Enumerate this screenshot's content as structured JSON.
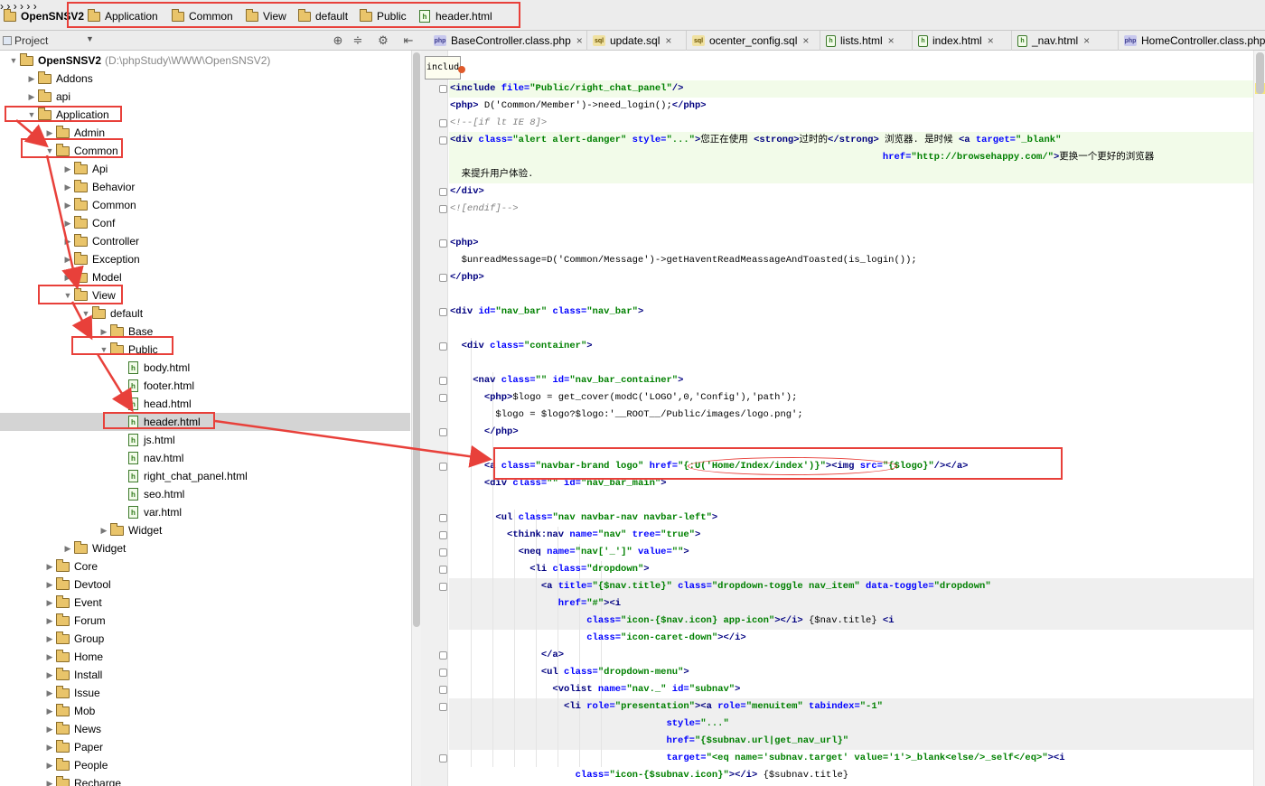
{
  "breadcrumb": {
    "items": [
      "OpenSNSV2",
      "Application",
      "Common",
      "View",
      "default",
      "Public",
      "header.html"
    ]
  },
  "project_panel": {
    "label": "Project",
    "toolbar_icons": [
      "target-icon",
      "collapse-icon",
      "gear-icon",
      "hide-panel-icon"
    ]
  },
  "tree": {
    "root_name": "OpenSNSV2",
    "root_path": "(D:\\phpStudy\\WWW\\OpenSNSV2)",
    "rows": [
      {
        "label": "Addons",
        "kind": "folder",
        "expanded": false,
        "level": 1
      },
      {
        "label": "api",
        "kind": "folder",
        "expanded": false,
        "level": 1
      },
      {
        "label": "Application",
        "kind": "folder",
        "expanded": true,
        "level": 1
      },
      {
        "label": "Admin",
        "kind": "folder",
        "expanded": false,
        "level": 2
      },
      {
        "label": "Common",
        "kind": "folder",
        "expanded": true,
        "level": 2
      },
      {
        "label": "Api",
        "kind": "folder",
        "expanded": false,
        "level": 3
      },
      {
        "label": "Behavior",
        "kind": "folder",
        "expanded": false,
        "level": 3
      },
      {
        "label": "Common",
        "kind": "folder",
        "expanded": false,
        "level": 3
      },
      {
        "label": "Conf",
        "kind": "folder",
        "expanded": false,
        "level": 3
      },
      {
        "label": "Controller",
        "kind": "folder",
        "expanded": false,
        "level": 3
      },
      {
        "label": "Exception",
        "kind": "folder",
        "expanded": false,
        "level": 3
      },
      {
        "label": "Model",
        "kind": "folder",
        "expanded": false,
        "level": 3
      },
      {
        "label": "View",
        "kind": "folder",
        "expanded": true,
        "level": 3
      },
      {
        "label": "default",
        "kind": "folder",
        "expanded": true,
        "level": 4
      },
      {
        "label": "Base",
        "kind": "folder",
        "expanded": false,
        "level": 5
      },
      {
        "label": "Public",
        "kind": "folder",
        "expanded": true,
        "level": 5
      },
      {
        "label": "body.html",
        "kind": "file",
        "level": 6
      },
      {
        "label": "footer.html",
        "kind": "file",
        "level": 6
      },
      {
        "label": "head.html",
        "kind": "file",
        "level": 6
      },
      {
        "label": "header.html",
        "kind": "file",
        "level": 6,
        "selected": true
      },
      {
        "label": "js.html",
        "kind": "file",
        "level": 6
      },
      {
        "label": "nav.html",
        "kind": "file",
        "level": 6
      },
      {
        "label": "right_chat_panel.html",
        "kind": "file",
        "level": 6
      },
      {
        "label": "seo.html",
        "kind": "file",
        "level": 6
      },
      {
        "label": "var.html",
        "kind": "file",
        "level": 6
      },
      {
        "label": "Widget",
        "kind": "folder",
        "expanded": false,
        "level": 5
      },
      {
        "label": "Widget",
        "kind": "folder",
        "expanded": false,
        "level": 3
      },
      {
        "label": "Core",
        "kind": "folder",
        "expanded": false,
        "level": 2
      },
      {
        "label": "Devtool",
        "kind": "folder",
        "expanded": false,
        "level": 2
      },
      {
        "label": "Event",
        "kind": "folder",
        "expanded": false,
        "level": 2
      },
      {
        "label": "Forum",
        "kind": "folder",
        "expanded": false,
        "level": 2
      },
      {
        "label": "Group",
        "kind": "folder",
        "expanded": false,
        "level": 2
      },
      {
        "label": "Home",
        "kind": "folder",
        "expanded": false,
        "level": 2
      },
      {
        "label": "Install",
        "kind": "folder",
        "expanded": false,
        "level": 2
      },
      {
        "label": "Issue",
        "kind": "folder",
        "expanded": false,
        "level": 2
      },
      {
        "label": "Mob",
        "kind": "folder",
        "expanded": false,
        "level": 2
      },
      {
        "label": "News",
        "kind": "folder",
        "expanded": false,
        "level": 2
      },
      {
        "label": "Paper",
        "kind": "folder",
        "expanded": false,
        "level": 2
      },
      {
        "label": "People",
        "kind": "folder",
        "expanded": false,
        "level": 2
      },
      {
        "label": "Recharge",
        "kind": "folder",
        "expanded": false,
        "level": 2
      }
    ]
  },
  "tabs": [
    {
      "label": "BaseController.class.php",
      "type": "php"
    },
    {
      "label": "update.sql",
      "type": "sql"
    },
    {
      "label": "ocenter_config.sql",
      "type": "sql"
    },
    {
      "label": "lists.html",
      "type": "html"
    },
    {
      "label": "index.html",
      "type": "html"
    },
    {
      "label": "_nav.html",
      "type": "html"
    },
    {
      "label": "HomeController.class.php",
      "type": "php"
    }
  ],
  "editor": {
    "breadcrumb_chip": "includ",
    "lines": [
      [
        [
          "tg",
          "<include "
        ],
        [
          "at",
          "file="
        ],
        [
          "vl",
          "\"Public/right_chat_panel\""
        ],
        [
          "tg",
          "/>"
        ]
      ],
      [
        [
          "tg",
          "<php"
        ],
        [
          "tg",
          ">"
        ],
        [
          "ph",
          " D('Common/Member')->need_login();"
        ],
        [
          "tg",
          "</php>"
        ]
      ],
      [
        [
          "cm",
          "<!--[if lt IE 8]>"
        ]
      ],
      [
        [
          "tg",
          "<div "
        ],
        [
          "at",
          "class="
        ],
        [
          "vl",
          "\"alert alert-danger\""
        ],
        [
          "at",
          " style="
        ],
        [
          "vl",
          "\"...\""
        ],
        [
          "tg",
          ">"
        ],
        [
          "ph",
          "您正在使用 "
        ],
        [
          "tg",
          "<strong>"
        ],
        [
          "ph",
          "过时的"
        ],
        [
          "tg",
          "</strong>"
        ],
        [
          "ph",
          " 浏览器. 是时候 "
        ],
        [
          "tg",
          "<a "
        ],
        [
          "at",
          "target="
        ],
        [
          "vl",
          "\"_blank\""
        ]
      ],
      [
        [
          "ph",
          "                                                                            "
        ],
        [
          "at",
          "href="
        ],
        [
          "vl",
          "\"http://browsehappy.com/\""
        ],
        [
          "tg",
          ">"
        ],
        [
          "ph",
          "更换一个更好的浏览器"
        ]
      ],
      [
        [
          "ph",
          "  来提升用户体验."
        ]
      ],
      [
        [
          "tg",
          "</div>"
        ]
      ],
      [
        [
          "cm",
          "<![endif]-->"
        ]
      ],
      [
        [
          "ph",
          ""
        ]
      ],
      [
        [
          "tg",
          "<php>"
        ]
      ],
      [
        [
          "ph",
          "  $unreadMessage=D('Common/Message')->getHaventReadMeassageAndToasted(is_login());"
        ]
      ],
      [
        [
          "tg",
          "</php>"
        ]
      ],
      [
        [
          "ph",
          ""
        ]
      ],
      [
        [
          "tg",
          "<div "
        ],
        [
          "at",
          "id="
        ],
        [
          "vl",
          "\"nav_bar\""
        ],
        [
          "at",
          " class="
        ],
        [
          "vl",
          "\"nav_bar\""
        ],
        [
          "tg",
          ">"
        ]
      ],
      [
        [
          "ph",
          ""
        ]
      ],
      [
        [
          "ph",
          "  "
        ],
        [
          "tg",
          "<div "
        ],
        [
          "at",
          "class="
        ],
        [
          "vl",
          "\"container\""
        ],
        [
          "tg",
          ">"
        ]
      ],
      [
        [
          "ph",
          ""
        ]
      ],
      [
        [
          "ph",
          "    "
        ],
        [
          "tg",
          "<nav "
        ],
        [
          "at",
          "class="
        ],
        [
          "vl",
          "\"\""
        ],
        [
          "at",
          " id="
        ],
        [
          "vl",
          "\"nav_bar_container\""
        ],
        [
          "tg",
          ">"
        ]
      ],
      [
        [
          "ph",
          "      "
        ],
        [
          "tg",
          "<php>"
        ],
        [
          "ph",
          "$logo = get_cover(modC('LOGO',0,'Config'),'path');"
        ]
      ],
      [
        [
          "ph",
          "        $logo = $logo?$logo:'__ROOT__/Public/images/logo.png';"
        ]
      ],
      [
        [
          "ph",
          "      "
        ],
        [
          "tg",
          "</php>"
        ]
      ],
      [
        [
          "ph",
          ""
        ]
      ],
      [
        [
          "ph",
          "      "
        ],
        [
          "tg",
          "<a "
        ],
        [
          "at",
          "class="
        ],
        [
          "vl",
          "\"navbar-brand logo\""
        ],
        [
          "at",
          " href="
        ],
        [
          "vl",
          "\"{:U('Home/Index/index')}\""
        ],
        [
          "tg",
          "><img "
        ],
        [
          "at",
          "src="
        ],
        [
          "vl",
          "\"{$logo}\""
        ],
        [
          "tg",
          "/></a>"
        ]
      ],
      [
        [
          "ph",
          "      "
        ],
        [
          "tg",
          "<div "
        ],
        [
          "at",
          "class="
        ],
        [
          "vl",
          "\"\""
        ],
        [
          "at",
          " id="
        ],
        [
          "vl",
          "\"nav_bar_main\""
        ],
        [
          "tg",
          ">"
        ]
      ],
      [
        [
          "ph",
          ""
        ]
      ],
      [
        [
          "ph",
          "        "
        ],
        [
          "tg",
          "<ul "
        ],
        [
          "at",
          "class="
        ],
        [
          "vl",
          "\"nav navbar-nav navbar-left\""
        ],
        [
          "tg",
          ">"
        ]
      ],
      [
        [
          "ph",
          "          "
        ],
        [
          "tg",
          "<think:nav "
        ],
        [
          "at",
          "name="
        ],
        [
          "vl",
          "\"nav\""
        ],
        [
          "at",
          " tree="
        ],
        [
          "vl",
          "\"true\""
        ],
        [
          "tg",
          ">"
        ]
      ],
      [
        [
          "ph",
          "            "
        ],
        [
          "tg",
          "<neq "
        ],
        [
          "at",
          "name="
        ],
        [
          "vl",
          "\"nav['_']\""
        ],
        [
          "at",
          " value="
        ],
        [
          "vl",
          "\"\""
        ],
        [
          "tg",
          ">"
        ]
      ],
      [
        [
          "ph",
          "              "
        ],
        [
          "tg",
          "<li "
        ],
        [
          "at",
          "class="
        ],
        [
          "vl",
          "\"dropdown\""
        ],
        [
          "tg",
          ">"
        ]
      ],
      [
        [
          "ph",
          "                "
        ],
        [
          "tg",
          "<a "
        ],
        [
          "at",
          "title="
        ],
        [
          "vl",
          "\"{$nav.title}\""
        ],
        [
          "at",
          " class="
        ],
        [
          "vl",
          "\"dropdown-toggle nav_item\""
        ],
        [
          "at",
          " data-toggle="
        ],
        [
          "vl",
          "\"dropdown\""
        ]
      ],
      [
        [
          "ph",
          "                   "
        ],
        [
          "at",
          "href="
        ],
        [
          "vl",
          "\"#\""
        ],
        [
          "tg",
          "><i"
        ]
      ],
      [
        [
          "ph",
          "                        "
        ],
        [
          "at",
          "class="
        ],
        [
          "vl",
          "\"icon-{$nav.icon} app-icon\""
        ],
        [
          "tg",
          "></i>"
        ],
        [
          "ph",
          " {$nav.title} "
        ],
        [
          "tg",
          "<i"
        ]
      ],
      [
        [
          "ph",
          "                        "
        ],
        [
          "at",
          "class="
        ],
        [
          "vl",
          "\"icon-caret-down\""
        ],
        [
          "tg",
          "></i>"
        ]
      ],
      [
        [
          "ph",
          "                "
        ],
        [
          "tg",
          "</a>"
        ]
      ],
      [
        [
          "ph",
          "                "
        ],
        [
          "tg",
          "<ul "
        ],
        [
          "at",
          "class="
        ],
        [
          "vl",
          "\"dropdown-menu\""
        ],
        [
          "tg",
          ">"
        ]
      ],
      [
        [
          "ph",
          "                  "
        ],
        [
          "tg",
          "<volist "
        ],
        [
          "at",
          "name="
        ],
        [
          "vl",
          "\"nav._\""
        ],
        [
          "at",
          " id="
        ],
        [
          "vl",
          "\"subnav\""
        ],
        [
          "tg",
          ">"
        ]
      ],
      [
        [
          "ph",
          "                    "
        ],
        [
          "tg",
          "<li "
        ],
        [
          "at",
          "role="
        ],
        [
          "vl",
          "\"presentation\""
        ],
        [
          "tg",
          "><a "
        ],
        [
          "at",
          "role="
        ],
        [
          "vl",
          "\"menuitem\""
        ],
        [
          "at",
          " tabindex="
        ],
        [
          "vl",
          "\"-1\""
        ]
      ],
      [
        [
          "ph",
          "                                      "
        ],
        [
          "at",
          "style="
        ],
        [
          "vl",
          "\"...\""
        ]
      ],
      [
        [
          "ph",
          "                                      "
        ],
        [
          "at",
          "href="
        ],
        [
          "vl",
          "\"{$subnav.url|get_nav_url}\""
        ]
      ],
      [
        [
          "ph",
          "                                      "
        ],
        [
          "at",
          "target="
        ],
        [
          "vl",
          "\"<eq name='subnav.target' value='1'>_blank<else/>_self</eq>\""
        ],
        [
          "tg",
          "><i"
        ]
      ],
      [
        [
          "ph",
          "                      "
        ],
        [
          "at",
          "class="
        ],
        [
          "vl",
          "\"icon-{$subnav.icon}\""
        ],
        [
          "tg",
          "></i>"
        ],
        [
          "ph",
          " {$subnav.title}"
        ]
      ]
    ]
  },
  "colors": {
    "annotation_red": "#e8403a",
    "selection_gray": "#d4d4d4",
    "folder_yellow": "#e9c46a"
  }
}
